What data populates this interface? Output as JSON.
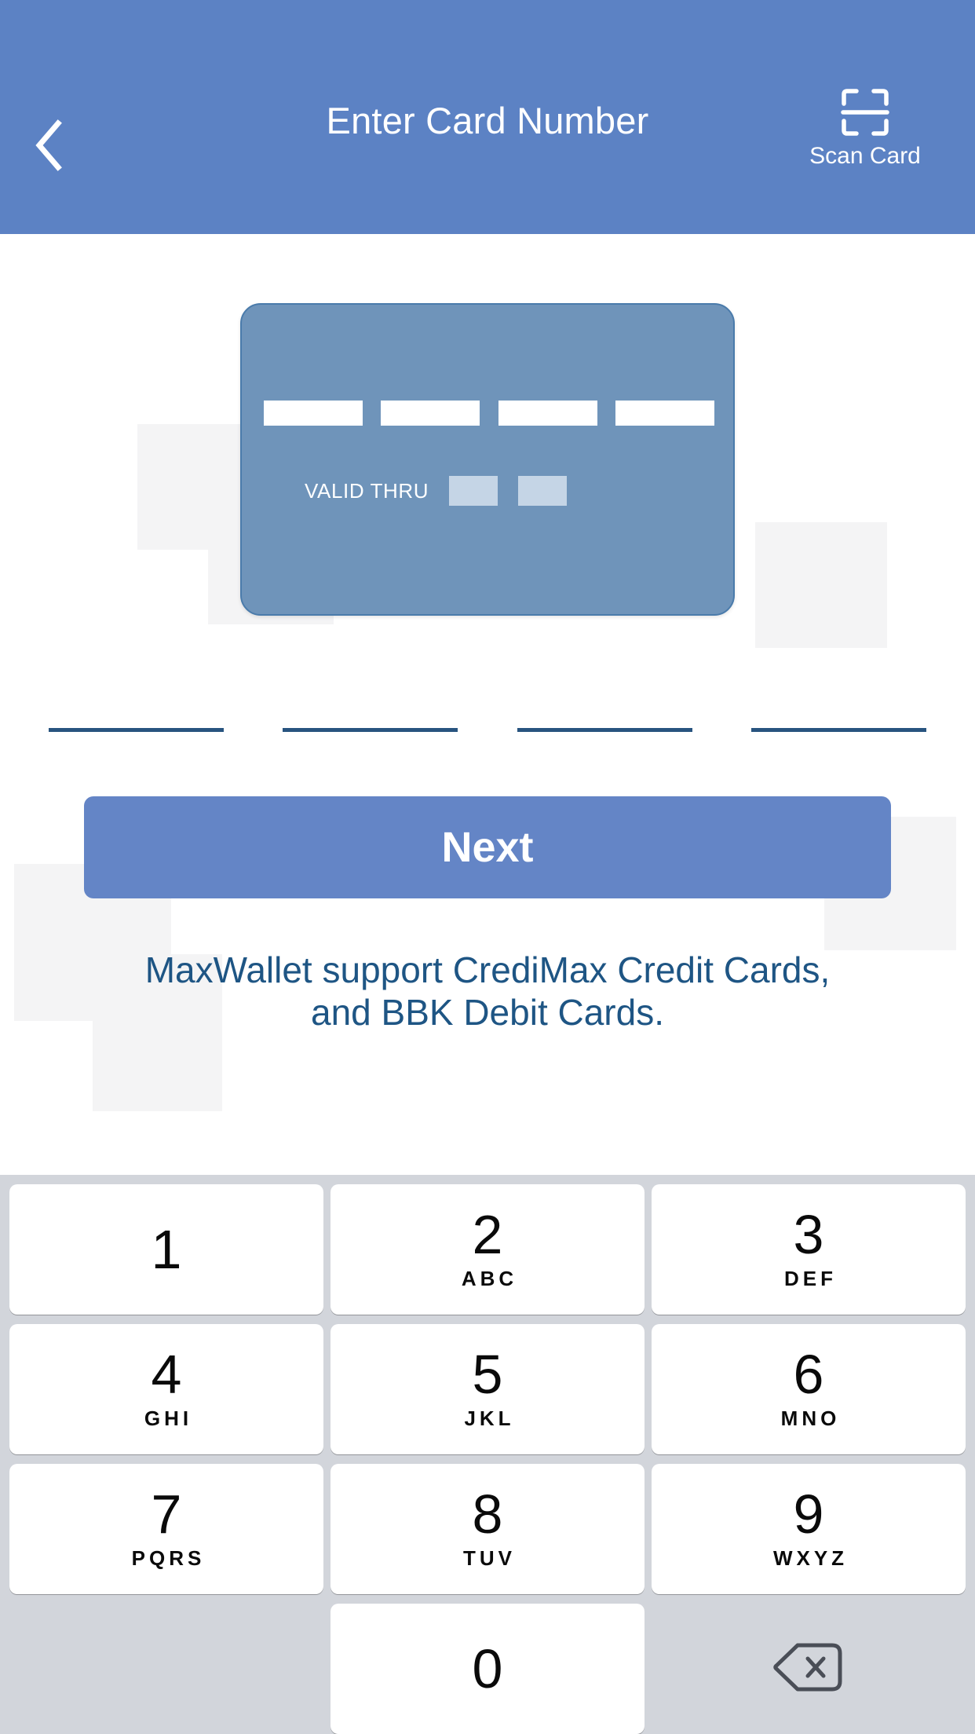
{
  "header": {
    "title": "Enter Card Number",
    "back_icon": "chevron-left-icon",
    "scan_icon": "scan-card-icon",
    "scan_label": "Scan Card",
    "background_color": "#5c82c4"
  },
  "card_graphic": {
    "background_color": "#6f94ba",
    "valid_thru_label": "VALID THRU",
    "number_blocks": [
      "",
      "",
      "",
      ""
    ],
    "expiry_boxes": [
      "",
      ""
    ]
  },
  "card_number_input": {
    "groups": [
      {
        "value": "",
        "placeholder": ""
      },
      {
        "value": "",
        "placeholder": ""
      },
      {
        "value": "",
        "placeholder": ""
      },
      {
        "value": "",
        "placeholder": ""
      }
    ],
    "underline_color": "#28547f"
  },
  "primary_action": {
    "label": "Next",
    "color": "#6485c6"
  },
  "support_note": {
    "line1": "MaxWallet support CrediMax Credit Cards,",
    "line2": "and BBK Debit Cards.",
    "color": "#1e5584"
  },
  "keypad": {
    "background_color": "#d2d5db",
    "delete_icon": "backspace-delete-icon",
    "rows": [
      [
        {
          "digit": "1",
          "letters": ""
        },
        {
          "digit": "2",
          "letters": "ABC"
        },
        {
          "digit": "3",
          "letters": "DEF"
        }
      ],
      [
        {
          "digit": "4",
          "letters": "GHI"
        },
        {
          "digit": "5",
          "letters": "JKL"
        },
        {
          "digit": "6",
          "letters": "MNO"
        }
      ],
      [
        {
          "digit": "7",
          "letters": "PQRS"
        },
        {
          "digit": "8",
          "letters": "TUV"
        },
        {
          "digit": "9",
          "letters": "WXYZ"
        }
      ],
      [
        {
          "digit": "",
          "letters": ""
        },
        {
          "digit": "0",
          "letters": ""
        },
        {
          "digit": "",
          "letters": ""
        }
      ]
    ]
  }
}
